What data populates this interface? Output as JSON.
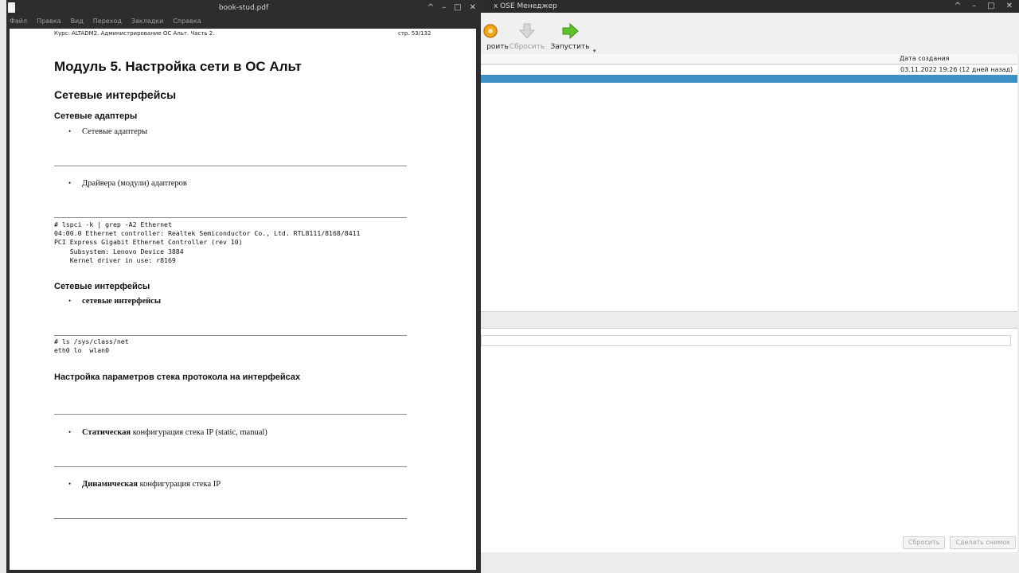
{
  "vbox": {
    "title": "x OSE Менеджер",
    "window_buttons": [
      "^",
      "–",
      "□",
      "✕"
    ],
    "toolbar": [
      {
        "label": "роить",
        "icon": "gear-icon",
        "disabled": false
      },
      {
        "label": "Сбросить",
        "icon": "down-arrow-icon",
        "disabled": true
      },
      {
        "label": "Запустить",
        "icon": "green-arrow-icon",
        "disabled": false
      }
    ],
    "dropdown_glyph": "▾",
    "snapshots": {
      "column_date": "Дата создания",
      "row_date": "03.11.2022 19:26 (12 дней назад)"
    },
    "bottom_buttons": [
      "Сбросить",
      "Сделать снимок"
    ]
  },
  "pdf": {
    "title": "book-stud.pdf",
    "window_buttons": [
      "^",
      "–",
      "□",
      "✕"
    ],
    "menu": [
      "Файл",
      "Правка",
      "Вид",
      "Переход",
      "Закладки",
      "Справка"
    ],
    "page": {
      "header_left": "Курс: ALTADM2. Администрирование ОС Альт. Часть 2.",
      "header_right": "стр. 53/132",
      "h1": "Модуль 5. Настройка сети в ОС Альт",
      "h2": "Сетевые интерфейсы",
      "sec_adapters": "Сетевые адаптеры",
      "bullet_adapters": "Сетевые адаптеры",
      "bullet_drivers": "Драйвера (модули) адаптеров",
      "code_lspci": [
        "# lspci -k | grep -A2 Ethernet",
        "04:00.0 Ethernet controller: Realtek Semiconductor Co., Ltd. RTL8111/8168/8411",
        "PCI Express Gigabit Ethernet Controller (rev 10)",
        "    Subsystem: Lenovo Device 3884",
        "    Kernel driver in use: r8169"
      ],
      "sec_interfaces": "Сетевые интерфейсы",
      "bullet_interfaces": "сетевые интерфейсы",
      "code_ls": [
        "# ls /sys/class/net",
        "eth0 lo  wlan0"
      ],
      "sec_stack": "Настройка параметров стека протокола на интерфейсах",
      "bullet_static_bold": "Статическая",
      "bullet_static_rest": " конфигурация стека IP (static, manual)",
      "bullet_dynamic_bold": "Динамическая",
      "bullet_dynamic_rest": " конфигурация стека IP"
    }
  }
}
